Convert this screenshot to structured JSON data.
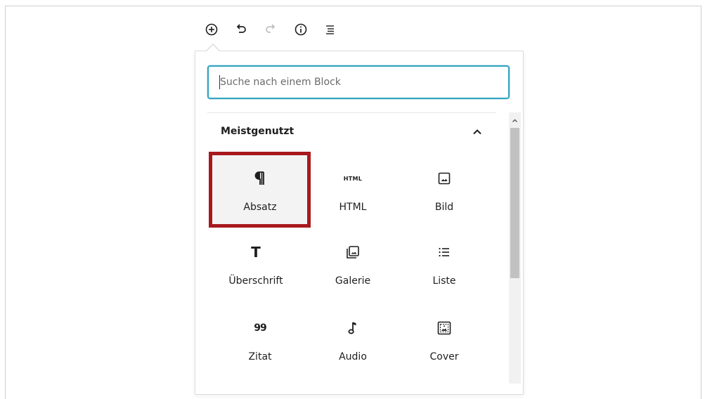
{
  "toolbar": {
    "buttons": [
      {
        "name": "add-block",
        "icon": "plus-circle-icon"
      },
      {
        "name": "undo",
        "icon": "undo-icon"
      },
      {
        "name": "redo",
        "icon": "redo-icon"
      },
      {
        "name": "info",
        "icon": "info-icon"
      },
      {
        "name": "outline",
        "icon": "list-outline-icon"
      }
    ]
  },
  "inserter": {
    "search": {
      "placeholder": "Suche nach einem Block",
      "value": ""
    },
    "section": {
      "title": "Meistgenutzt",
      "expanded": true
    },
    "blocks": [
      {
        "label": "Absatz",
        "icon": "paragraph-icon",
        "selected": true
      },
      {
        "label": "HTML",
        "icon": "html-icon",
        "icon_text": "HTML"
      },
      {
        "label": "Bild",
        "icon": "image-icon"
      },
      {
        "label": "Überschrift",
        "icon": "heading-icon",
        "icon_text": "T"
      },
      {
        "label": "Galerie",
        "icon": "gallery-icon"
      },
      {
        "label": "Liste",
        "icon": "list-icon"
      },
      {
        "label": "Zitat",
        "icon": "quote-icon",
        "icon_text": "99"
      },
      {
        "label": "Audio",
        "icon": "audio-icon"
      },
      {
        "label": "Cover",
        "icon": "cover-icon"
      }
    ]
  },
  "colors": {
    "highlight_border": "#a8191d",
    "search_focus": "#31a4c0",
    "text": "#1e1e1e",
    "scrollbar_thumb": "#c1c1c1"
  }
}
